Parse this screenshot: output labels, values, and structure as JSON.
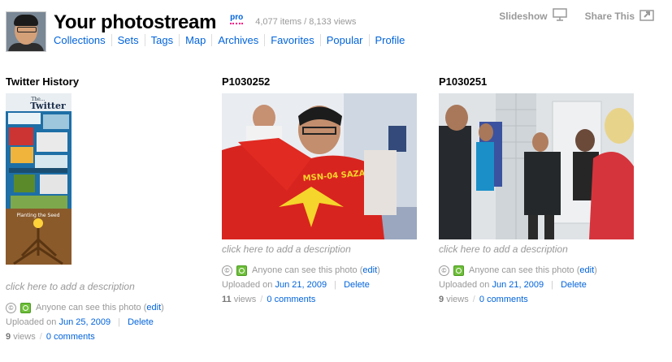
{
  "header": {
    "title": "Your photostream",
    "pro_label": "pro",
    "stats": "4,077 items / 8,133 views",
    "nav": [
      "Collections",
      "Sets",
      "Tags",
      "Map",
      "Archives",
      "Favorites",
      "Popular",
      "Profile"
    ],
    "slideshow_label": "Slideshow",
    "share_label": "Share This"
  },
  "photos": [
    {
      "title": "Twitter History",
      "description_placeholder": "click here to add a description",
      "privacy_text": "Anyone can see this photo",
      "edit_label": "edit",
      "uploaded_prefix": "Uploaded on",
      "upload_date": "Jun 25, 2009",
      "delete_label": "Delete",
      "views": "9",
      "views_suffix": "views",
      "comments": "0 comments"
    },
    {
      "title": "P1030252",
      "description_placeholder": "click here to add a description",
      "privacy_text": "Anyone can see this photo",
      "edit_label": "edit",
      "uploaded_prefix": "Uploaded on",
      "upload_date": "Jun 21, 2009",
      "delete_label": "Delete",
      "views": "11",
      "views_suffix": "views",
      "comments": "0 comments"
    },
    {
      "title": "P1030251",
      "description_placeholder": "click here to add a description",
      "privacy_text": "Anyone can see this photo",
      "edit_label": "edit",
      "uploaded_prefix": "Uploaded on",
      "upload_date": "Jun 21, 2009",
      "delete_label": "Delete",
      "views": "9",
      "views_suffix": "views",
      "comments": "0 comments"
    }
  ],
  "colors": {
    "link": "#0063dc",
    "pro_underline": "#ff0084",
    "muted": "#999999",
    "public_badge": "#6fbf3a"
  }
}
